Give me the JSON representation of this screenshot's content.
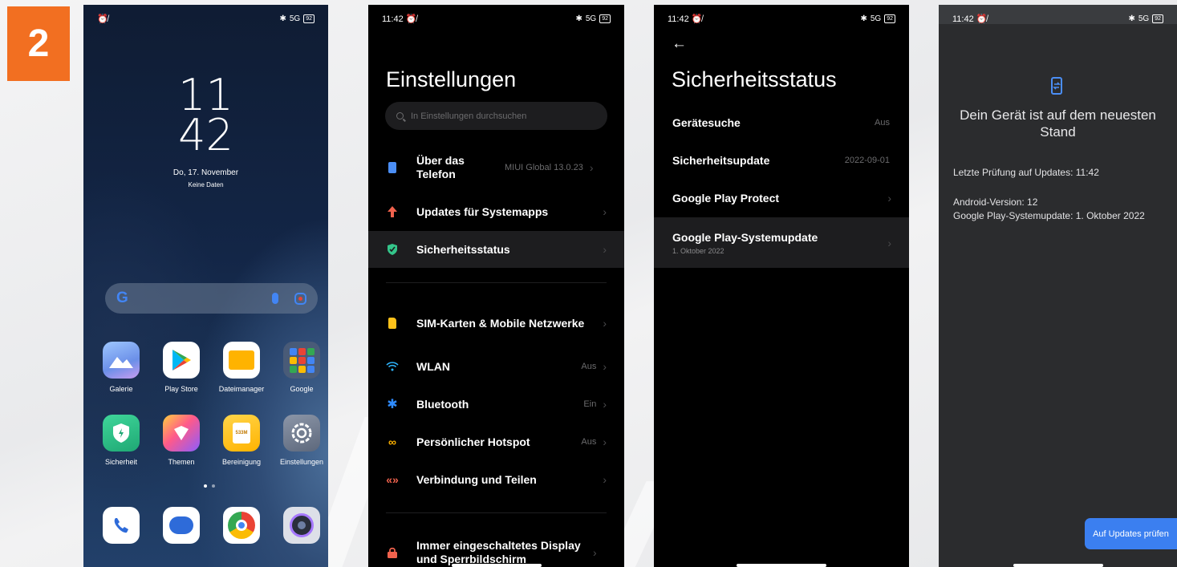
{
  "step": "2",
  "phone1": {
    "status_bar": {
      "signal_text": "5G",
      "battery": "92"
    },
    "clock_hour": "11",
    "clock_minute": "42",
    "date": "Do, 17. November",
    "weather": "Keine Daten",
    "search_logo": "G",
    "apps_row1": [
      {
        "label": "Galerie",
        "icon": "gallery-icon"
      },
      {
        "label": "Play Store",
        "icon": "play-store-icon"
      },
      {
        "label": "Dateimanager",
        "icon": "file-manager-icon"
      },
      {
        "label": "Google",
        "icon": "google-folder-icon"
      }
    ],
    "apps_row2": [
      {
        "label": "Sicherheit",
        "icon": "security-shield-icon"
      },
      {
        "label": "Themen",
        "icon": "themes-icon"
      },
      {
        "label": "Bereinigung",
        "icon": "cleaner-icon",
        "badge": "533M"
      },
      {
        "label": "Einstellungen",
        "icon": "settings-gear-icon"
      }
    ],
    "dock": [
      {
        "icon": "phone-icon"
      },
      {
        "icon": "messages-icon"
      },
      {
        "icon": "chrome-icon"
      },
      {
        "icon": "camera-icon"
      }
    ]
  },
  "phone2": {
    "status_time": "11:42",
    "title": "Einstellungen",
    "search_placeholder": "In Einstellungen durchsuchen",
    "items": [
      {
        "label": "Über das Telefon",
        "value": "MIUI Global 13.0.23",
        "icon": "phone-info-icon"
      },
      {
        "label": "Updates für Systemapps",
        "value": "",
        "icon": "arrow-up-icon"
      },
      {
        "label": "Sicherheitsstatus",
        "value": "",
        "icon": "shield-check-icon",
        "selected": true
      },
      {
        "label": "SIM-Karten & Mobile Netzwerke",
        "value": "",
        "icon": "sim-card-icon"
      },
      {
        "label": "WLAN",
        "value": "Aus",
        "icon": "wifi-icon"
      },
      {
        "label": "Bluetooth",
        "value": "Ein",
        "icon": "bluetooth-icon"
      },
      {
        "label": "Persönlicher Hotspot",
        "value": "Aus",
        "icon": "hotspot-icon"
      },
      {
        "label": "Verbindung und Teilen",
        "value": "",
        "icon": "connection-share-icon"
      },
      {
        "label": "Immer eingeschaltetes Display und Sperrbildschirm",
        "value": "",
        "icon": "lock-icon"
      }
    ]
  },
  "phone3": {
    "status_time": "11:42",
    "title": "Sicherheitsstatus",
    "items": [
      {
        "label": "Gerätesuche",
        "value": "Aus",
        "sub": ""
      },
      {
        "label": "Sicherheitsupdate",
        "value": "2022-09-01",
        "sub": ""
      },
      {
        "label": "Google Play Protect",
        "value": "",
        "sub": ""
      },
      {
        "label": "Google Play-Systemupdate",
        "value": "",
        "sub": "1. Oktober 2022",
        "selected": true
      }
    ]
  },
  "phone4": {
    "status_time": "11:42",
    "headline": "Dein Gerät ist auf dem neuesten Stand",
    "last_check": "Letzte Prüfung auf Updates: 11:42",
    "android_version": "Android-Version: 12",
    "play_update": "Google Play-Systemupdate: 1. Oktober 2022",
    "button": "Auf Updates prüfen"
  },
  "colors": {
    "badge": "#f26f21",
    "accent_blue": "#3b7ff0",
    "shield_green": "#34c58a",
    "update_arrow": "#f0624d"
  }
}
